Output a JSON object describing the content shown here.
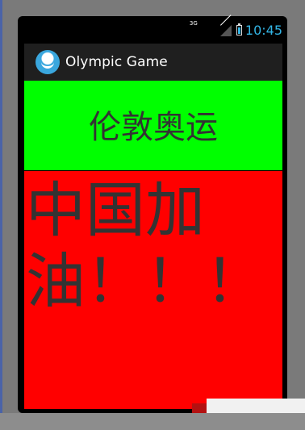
{
  "status_bar": {
    "network_label": "3G",
    "time": "10:45",
    "icons": [
      "signal-icon",
      "battery-icon"
    ],
    "accent_color": "#33b5e5"
  },
  "action_bar": {
    "title": "Olympic Game",
    "icon": "app-icon"
  },
  "panels": {
    "green_text": "伦敦奥运",
    "red_text": "中国加油！！！",
    "green_color": "#00ff00",
    "red_color": "#ff0000"
  }
}
